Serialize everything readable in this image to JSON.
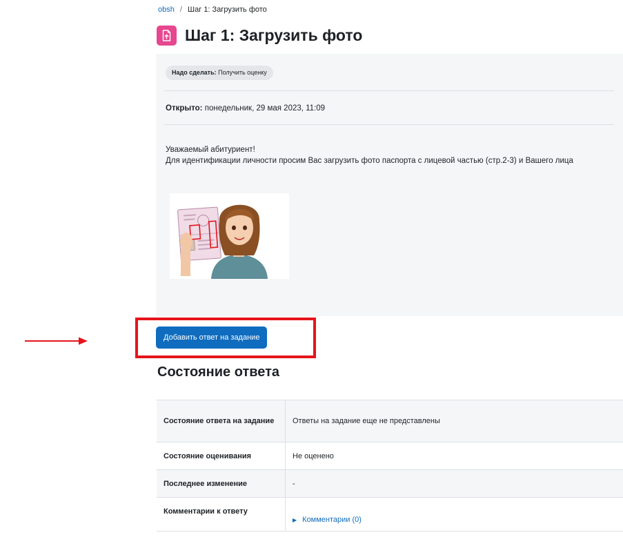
{
  "breadcrumb": {
    "course": "obsh",
    "separator": "/",
    "current": "Шаг 1: Загрузить фото"
  },
  "header": {
    "icon": "assignment-upload-icon",
    "icon_color": "#e6478f",
    "title": "Шаг 1: Загрузить фото"
  },
  "activity": {
    "todo_label": "Надо сделать:",
    "todo_value": "Получить оценку",
    "opened_label": "Открыто:",
    "opened_value": "понедельник, 29 мая 2023, 11:09",
    "intro_line1": "Уважаемый абитуриент!",
    "intro_line2": "Для идентификации личности просим Вас загрузить фото паспорта с лицевой частью (стр.2-3) и Вашего лица",
    "image": "woman-holding-passport-illustration"
  },
  "actions": {
    "add_submission": "Добавить ответ на задание",
    "button_color": "#0f6cbf",
    "highlight_color": "#e5141c"
  },
  "submission_status": {
    "title": "Состояние ответа",
    "rows": [
      {
        "label": "Состояние ответа на задание",
        "value": "Ответы на задание еще не представлены"
      },
      {
        "label": "Состояние оценивания",
        "value": "Не оценено"
      },
      {
        "label": "Последнее изменение",
        "value": "-"
      },
      {
        "label": "Комментарии к ответу",
        "value": "Комментарии (0)"
      }
    ]
  }
}
